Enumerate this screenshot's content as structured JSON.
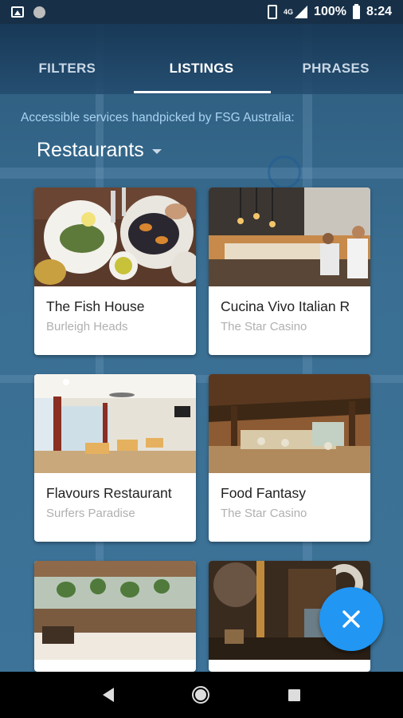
{
  "status_bar": {
    "network": "4G",
    "battery": "100%",
    "time": "8:24"
  },
  "tabs": [
    {
      "label": "FILTERS",
      "active": false
    },
    {
      "label": "LISTINGS",
      "active": true
    },
    {
      "label": "PHRASES",
      "active": false
    }
  ],
  "subtitle": "Accessible services handpicked by FSG Australia:",
  "category": {
    "selected": "Restaurants"
  },
  "listings": [
    {
      "title": "The Fish House",
      "location": "Burleigh Heads"
    },
    {
      "title": "Cucina Vivo Italian R",
      "location": "The Star Casino"
    },
    {
      "title": "Flavours Restaurant",
      "location": "Surfers Paradise"
    },
    {
      "title": "Food Fantasy",
      "location": "The Star Casino"
    },
    {
      "title": "",
      "location": ""
    },
    {
      "title": "",
      "location": ""
    }
  ],
  "fab": {
    "icon": "close-icon"
  },
  "colors": {
    "accent": "#2196f3",
    "tab_bar": "#173048",
    "subtitle": "#a9d2f2"
  }
}
